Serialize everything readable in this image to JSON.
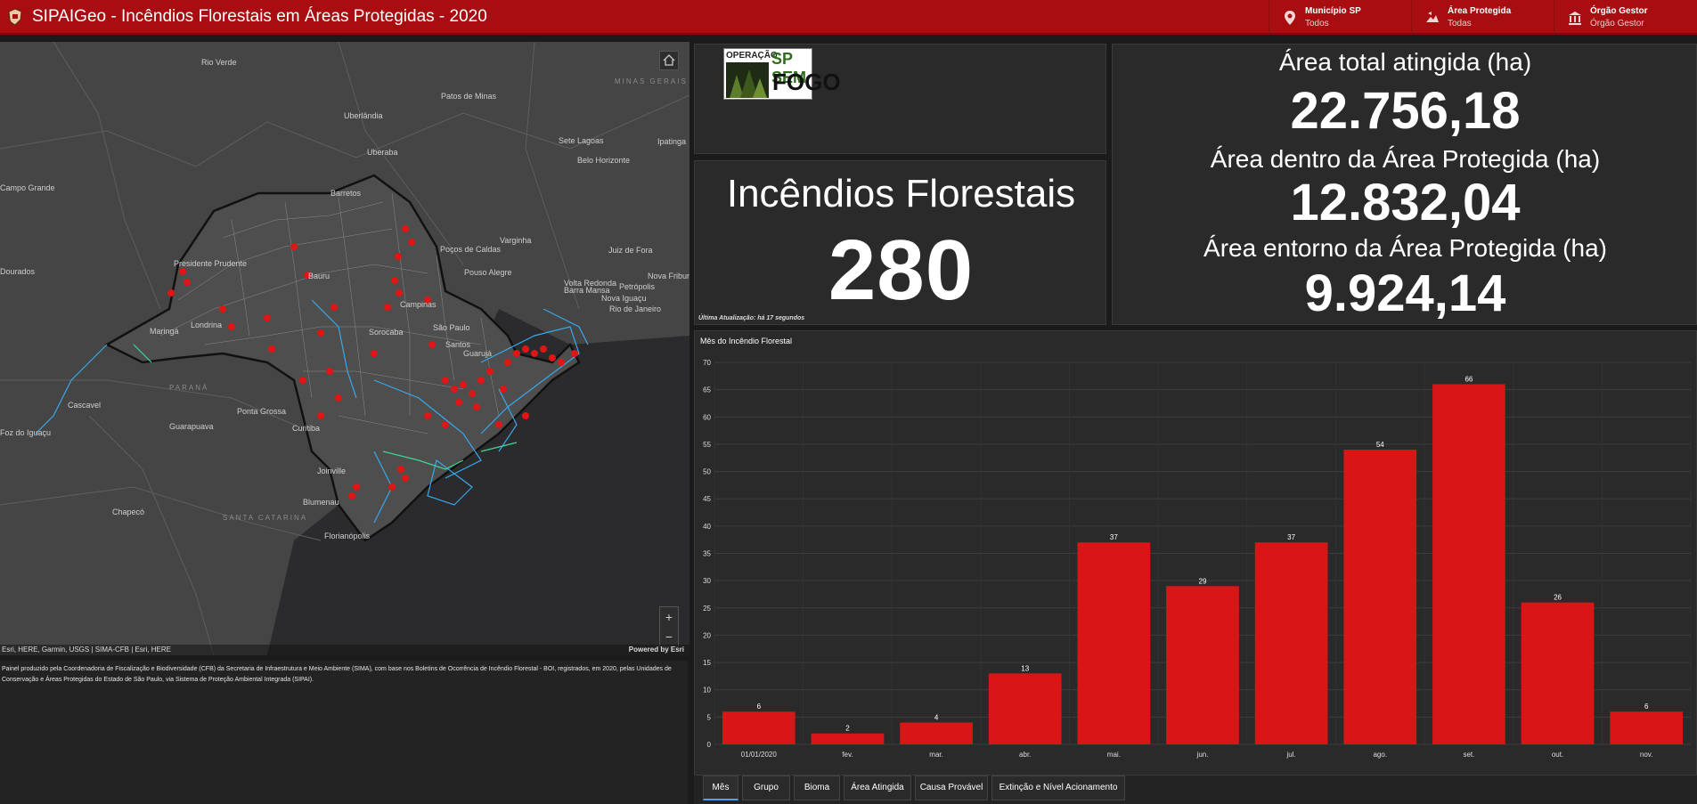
{
  "header": {
    "title": "SIPAIGeo - Incêndios Florestais em Áreas Protegidas - 2020",
    "filters": [
      {
        "label": "Município SP",
        "value": "Todos",
        "icon": "map-pin-icon"
      },
      {
        "label": "Área Protegida",
        "value": "Todas",
        "icon": "protected-area-icon"
      },
      {
        "label": "Órgão Gestor",
        "value": "Órgão Gestor",
        "icon": "building-icon"
      }
    ]
  },
  "map": {
    "cities": [
      "Rio Verde",
      "Uberlândia",
      "Patos de Minas",
      "Uberaba",
      "Sete Lagoas",
      "Ipatinga",
      "Belo Horizonte",
      "Campo Grande",
      "Varginha",
      "Pouso Alegre",
      "Juiz de Fora",
      "Nova Friburgo",
      "Petrópolis",
      "Rio de Janeiro",
      "Volta Redonda",
      "Barra Mansa",
      "Nova Iguaçu",
      "Maringá",
      "Londrina",
      "Cascavel",
      "Ponta Grossa",
      "Guarapuava",
      "Curitiba",
      "Foz do Iguaçu",
      "Joinville",
      "Blumenau",
      "Chapecó",
      "Florianópolis",
      "Dourados",
      "Barretos",
      "Poços de Caldas",
      "Campinas",
      "Sorocaba",
      "São Paulo",
      "Santos",
      "Guarujá",
      "Presidente Prudente",
      "Bauru"
    ],
    "state_labels": [
      "MINAS GERAIS",
      "PARANÁ",
      "SANTA CATARINA"
    ],
    "attribution": "Esri, HERE, Garmin, USGS | SIMA-CFB | Esri, HERE",
    "powered_by": "Powered by Esri"
  },
  "map_description": "Painel produzido pela Coordenadoria de Fiscalização e Biodiversidade (CFB) da Secretaria de Infraestrutura e Meio Ambiente (SIMA), com base nos Boletins de Ocorrência de Incêndio Florestal - BOI, registrados, em 2020, pelas Unidades de Conservação e Áreas Protegidas do Estado de São Paulo, via Sistema de Proteção Ambiental Integrada (SIPAI).",
  "logo": {
    "line1": "OPERAÇÃO",
    "line2": "SP SEM",
    "line3": "FOGO"
  },
  "fires": {
    "title": "Incêndios Florestais",
    "count": "280",
    "last_update": "Última Atualização: há 17 segundos"
  },
  "areas": {
    "total_label": "Área total atingida (ha)",
    "total_value": "22.756,18",
    "inside_label": "Área dentro da Área Protegida (ha)",
    "inside_value": "12.832,04",
    "around_label": "Área entorno da Área Protegida (ha)",
    "around_value": "9.924,14"
  },
  "chart_data": {
    "type": "bar",
    "title": "Mês do Incêndio Florestal",
    "categories": [
      "01/01/2020",
      "fev.",
      "mar.",
      "abr.",
      "mai.",
      "jun.",
      "jul.",
      "ago.",
      "set.",
      "out.",
      "nov."
    ],
    "values": [
      6,
      2,
      4,
      13,
      37,
      29,
      37,
      54,
      66,
      26,
      6
    ],
    "ylim": [
      0,
      70
    ],
    "yticks": [
      0,
      5,
      10,
      15,
      20,
      25,
      30,
      35,
      40,
      45,
      50,
      55,
      60,
      65,
      70
    ],
    "grid": true,
    "bar_color": "#d81616"
  },
  "tabs": [
    "Mês",
    "Grupo",
    "Bioma",
    "Área Atingida",
    "Causa Provável",
    "Extinção e Nível Acionamento"
  ]
}
